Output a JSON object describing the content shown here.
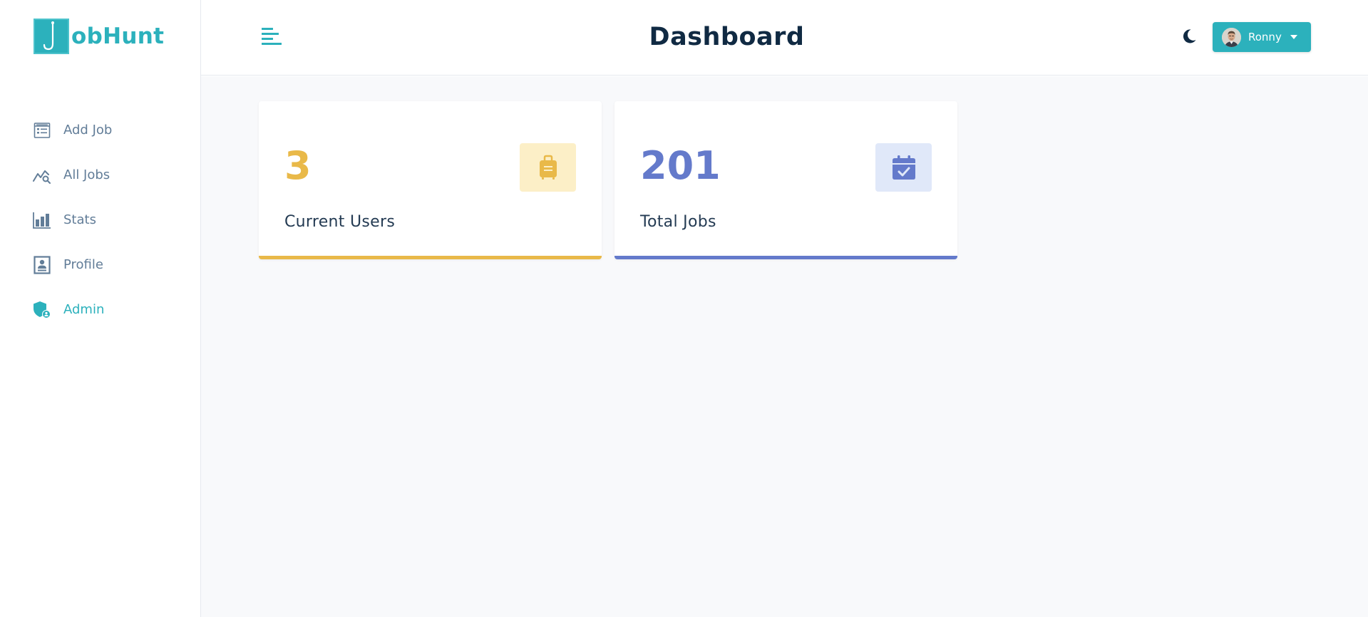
{
  "app": {
    "logo_text": "obHunt",
    "brand_color": "#2cb1bc"
  },
  "sidebar": {
    "items": [
      {
        "label": "Add Job",
        "icon": "add-job-icon",
        "active": false
      },
      {
        "label": "All Jobs",
        "icon": "all-jobs-icon",
        "active": false
      },
      {
        "label": "Stats",
        "icon": "stats-icon",
        "active": false
      },
      {
        "label": "Profile",
        "icon": "profile-icon",
        "active": false
      },
      {
        "label": "Admin",
        "icon": "admin-shield-icon",
        "active": true
      }
    ]
  },
  "header": {
    "title": "Dashboard",
    "user_name": "Ronny",
    "theme_icon": "moon-icon"
  },
  "stats": [
    {
      "count": "3",
      "label": "Current Users",
      "icon": "suitcase-icon",
      "color": "#e9b949",
      "bg": "#fcefc7"
    },
    {
      "count": "201",
      "label": "Total Jobs",
      "icon": "calendar-check-icon",
      "color": "#647acb",
      "bg": "#e0e8f9"
    }
  ]
}
